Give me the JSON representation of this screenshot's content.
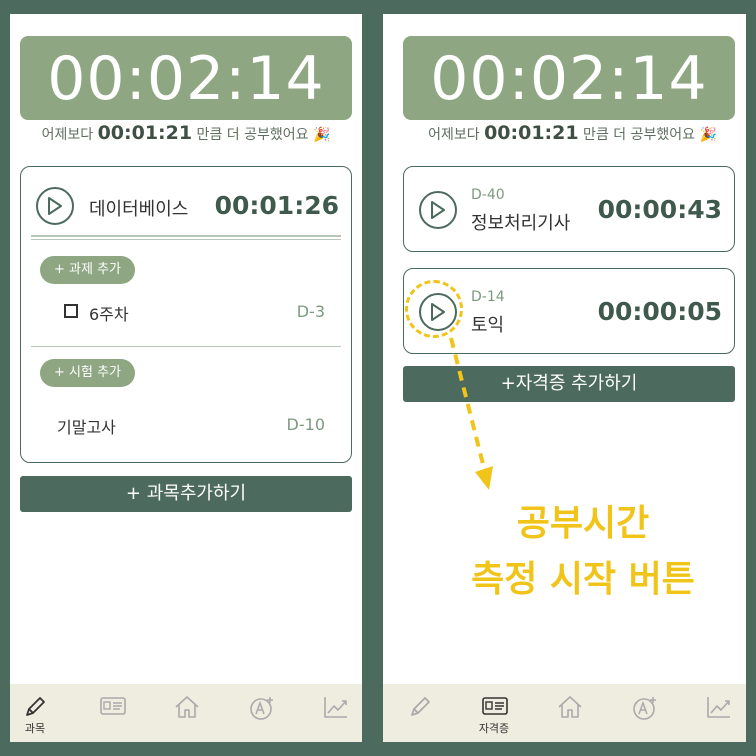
{
  "left": {
    "timer": "00:02:14",
    "compare": {
      "prefix": "어제보다 ",
      "time": "00:01:21",
      "suffix": " 만큼 더 공부했어요 🎉"
    },
    "subject": {
      "name": "데이터베이스",
      "time": "00:01:26"
    },
    "add_task_label": "+ 과제 추가",
    "task": {
      "name": "6주차",
      "dday": "D-3"
    },
    "add_exam_label": "+ 시험 추가",
    "exam": {
      "name": "기말고사",
      "dday": "D-10"
    },
    "add_subject_label": "+ 과목추가하기",
    "nav": {
      "active_label": "과목"
    }
  },
  "right": {
    "timer": "00:02:14",
    "compare": {
      "prefix": "어제보다 ",
      "time": "00:01:21",
      "suffix": " 만큼 더 공부했어요 🎉"
    },
    "certs": [
      {
        "dday": "D-40",
        "name": "정보처리기사",
        "time": "00:00:43"
      },
      {
        "dday": "D-14",
        "name": "토익",
        "time": "00:00:05"
      }
    ],
    "add_cert_label": "+자격증 추가하기",
    "nav": {
      "active_label": "자격증"
    },
    "annotation": {
      "line1": "공부시간",
      "line2": "측정 시작 버튼"
    }
  },
  "colors": {
    "primary": "#4c6a5d",
    "accent": "#8ea682",
    "nav_bg": "#efece0",
    "annotation": "#f0c419"
  },
  "icons": [
    "pencil-icon",
    "id-card-icon",
    "home-icon",
    "grade-icon",
    "chart-icon",
    "play-icon"
  ]
}
